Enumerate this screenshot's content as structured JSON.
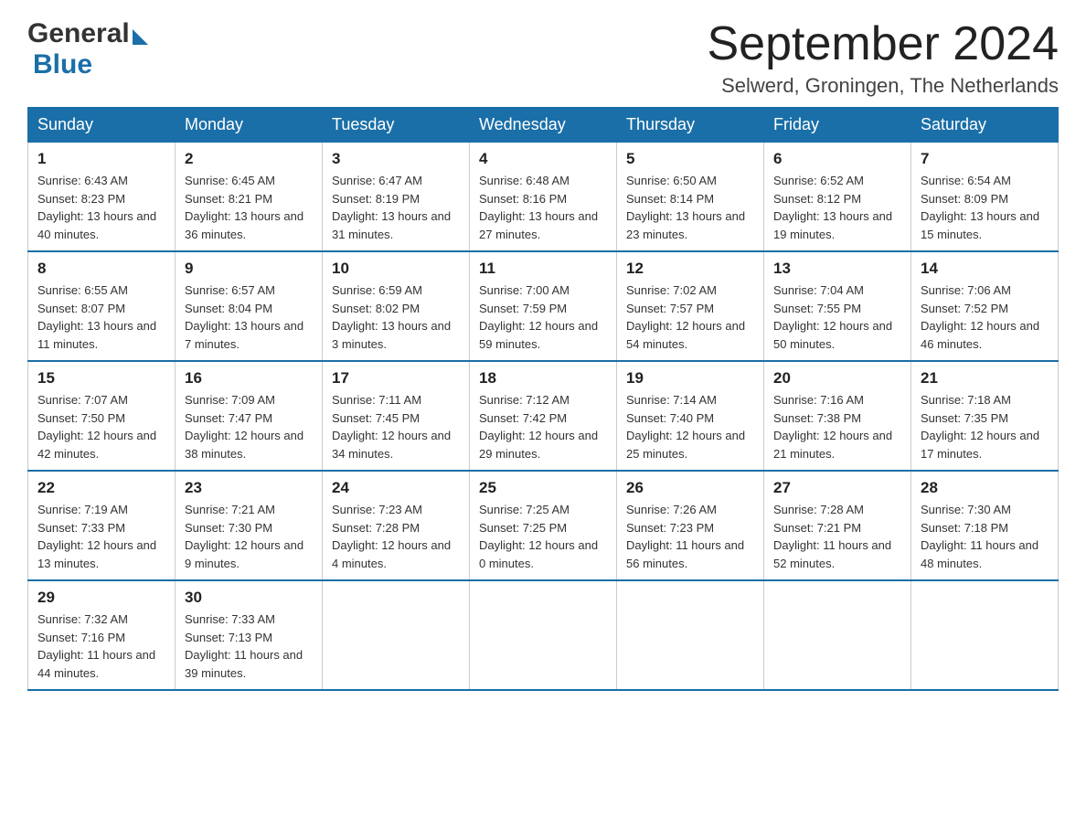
{
  "header": {
    "logo": {
      "text_general": "General",
      "text_blue": "Blue"
    },
    "title": "September 2024",
    "location": "Selwerd, Groningen, The Netherlands"
  },
  "days_of_week": [
    "Sunday",
    "Monday",
    "Tuesday",
    "Wednesday",
    "Thursday",
    "Friday",
    "Saturday"
  ],
  "weeks": [
    [
      {
        "day": "1",
        "sunrise": "Sunrise: 6:43 AM",
        "sunset": "Sunset: 8:23 PM",
        "daylight": "Daylight: 13 hours and 40 minutes."
      },
      {
        "day": "2",
        "sunrise": "Sunrise: 6:45 AM",
        "sunset": "Sunset: 8:21 PM",
        "daylight": "Daylight: 13 hours and 36 minutes."
      },
      {
        "day": "3",
        "sunrise": "Sunrise: 6:47 AM",
        "sunset": "Sunset: 8:19 PM",
        "daylight": "Daylight: 13 hours and 31 minutes."
      },
      {
        "day": "4",
        "sunrise": "Sunrise: 6:48 AM",
        "sunset": "Sunset: 8:16 PM",
        "daylight": "Daylight: 13 hours and 27 minutes."
      },
      {
        "day": "5",
        "sunrise": "Sunrise: 6:50 AM",
        "sunset": "Sunset: 8:14 PM",
        "daylight": "Daylight: 13 hours and 23 minutes."
      },
      {
        "day": "6",
        "sunrise": "Sunrise: 6:52 AM",
        "sunset": "Sunset: 8:12 PM",
        "daylight": "Daylight: 13 hours and 19 minutes."
      },
      {
        "day": "7",
        "sunrise": "Sunrise: 6:54 AM",
        "sunset": "Sunset: 8:09 PM",
        "daylight": "Daylight: 13 hours and 15 minutes."
      }
    ],
    [
      {
        "day": "8",
        "sunrise": "Sunrise: 6:55 AM",
        "sunset": "Sunset: 8:07 PM",
        "daylight": "Daylight: 13 hours and 11 minutes."
      },
      {
        "day": "9",
        "sunrise": "Sunrise: 6:57 AM",
        "sunset": "Sunset: 8:04 PM",
        "daylight": "Daylight: 13 hours and 7 minutes."
      },
      {
        "day": "10",
        "sunrise": "Sunrise: 6:59 AM",
        "sunset": "Sunset: 8:02 PM",
        "daylight": "Daylight: 13 hours and 3 minutes."
      },
      {
        "day": "11",
        "sunrise": "Sunrise: 7:00 AM",
        "sunset": "Sunset: 7:59 PM",
        "daylight": "Daylight: 12 hours and 59 minutes."
      },
      {
        "day": "12",
        "sunrise": "Sunrise: 7:02 AM",
        "sunset": "Sunset: 7:57 PM",
        "daylight": "Daylight: 12 hours and 54 minutes."
      },
      {
        "day": "13",
        "sunrise": "Sunrise: 7:04 AM",
        "sunset": "Sunset: 7:55 PM",
        "daylight": "Daylight: 12 hours and 50 minutes."
      },
      {
        "day": "14",
        "sunrise": "Sunrise: 7:06 AM",
        "sunset": "Sunset: 7:52 PM",
        "daylight": "Daylight: 12 hours and 46 minutes."
      }
    ],
    [
      {
        "day": "15",
        "sunrise": "Sunrise: 7:07 AM",
        "sunset": "Sunset: 7:50 PM",
        "daylight": "Daylight: 12 hours and 42 minutes."
      },
      {
        "day": "16",
        "sunrise": "Sunrise: 7:09 AM",
        "sunset": "Sunset: 7:47 PM",
        "daylight": "Daylight: 12 hours and 38 minutes."
      },
      {
        "day": "17",
        "sunrise": "Sunrise: 7:11 AM",
        "sunset": "Sunset: 7:45 PM",
        "daylight": "Daylight: 12 hours and 34 minutes."
      },
      {
        "day": "18",
        "sunrise": "Sunrise: 7:12 AM",
        "sunset": "Sunset: 7:42 PM",
        "daylight": "Daylight: 12 hours and 29 minutes."
      },
      {
        "day": "19",
        "sunrise": "Sunrise: 7:14 AM",
        "sunset": "Sunset: 7:40 PM",
        "daylight": "Daylight: 12 hours and 25 minutes."
      },
      {
        "day": "20",
        "sunrise": "Sunrise: 7:16 AM",
        "sunset": "Sunset: 7:38 PM",
        "daylight": "Daylight: 12 hours and 21 minutes."
      },
      {
        "day": "21",
        "sunrise": "Sunrise: 7:18 AM",
        "sunset": "Sunset: 7:35 PM",
        "daylight": "Daylight: 12 hours and 17 minutes."
      }
    ],
    [
      {
        "day": "22",
        "sunrise": "Sunrise: 7:19 AM",
        "sunset": "Sunset: 7:33 PM",
        "daylight": "Daylight: 12 hours and 13 minutes."
      },
      {
        "day": "23",
        "sunrise": "Sunrise: 7:21 AM",
        "sunset": "Sunset: 7:30 PM",
        "daylight": "Daylight: 12 hours and 9 minutes."
      },
      {
        "day": "24",
        "sunrise": "Sunrise: 7:23 AM",
        "sunset": "Sunset: 7:28 PM",
        "daylight": "Daylight: 12 hours and 4 minutes."
      },
      {
        "day": "25",
        "sunrise": "Sunrise: 7:25 AM",
        "sunset": "Sunset: 7:25 PM",
        "daylight": "Daylight: 12 hours and 0 minutes."
      },
      {
        "day": "26",
        "sunrise": "Sunrise: 7:26 AM",
        "sunset": "Sunset: 7:23 PM",
        "daylight": "Daylight: 11 hours and 56 minutes."
      },
      {
        "day": "27",
        "sunrise": "Sunrise: 7:28 AM",
        "sunset": "Sunset: 7:21 PM",
        "daylight": "Daylight: 11 hours and 52 minutes."
      },
      {
        "day": "28",
        "sunrise": "Sunrise: 7:30 AM",
        "sunset": "Sunset: 7:18 PM",
        "daylight": "Daylight: 11 hours and 48 minutes."
      }
    ],
    [
      {
        "day": "29",
        "sunrise": "Sunrise: 7:32 AM",
        "sunset": "Sunset: 7:16 PM",
        "daylight": "Daylight: 11 hours and 44 minutes."
      },
      {
        "day": "30",
        "sunrise": "Sunrise: 7:33 AM",
        "sunset": "Sunset: 7:13 PM",
        "daylight": "Daylight: 11 hours and 39 minutes."
      },
      null,
      null,
      null,
      null,
      null
    ]
  ]
}
